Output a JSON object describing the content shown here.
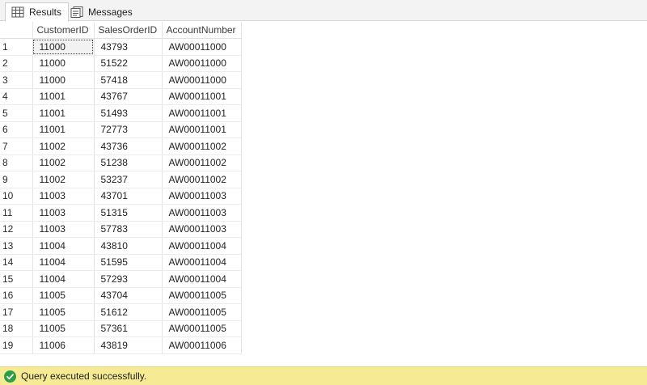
{
  "tabs": {
    "results_label": "Results",
    "messages_label": "Messages",
    "results_icon": "grid-icon",
    "messages_icon": "messages-icon"
  },
  "grid": {
    "columns": [
      "CustomerID",
      "SalesOrderID",
      "AccountNumber"
    ],
    "selected_cell": {
      "row": 1,
      "column": "CustomerID"
    },
    "rows": [
      {
        "n": "1",
        "customer": "11000",
        "order": "43793",
        "account": "AW00011000"
      },
      {
        "n": "2",
        "customer": "11000",
        "order": "51522",
        "account": "AW00011000"
      },
      {
        "n": "3",
        "customer": "11000",
        "order": "57418",
        "account": "AW00011000"
      },
      {
        "n": "4",
        "customer": "11001",
        "order": "43767",
        "account": "AW00011001"
      },
      {
        "n": "5",
        "customer": "11001",
        "order": "51493",
        "account": "AW00011001"
      },
      {
        "n": "6",
        "customer": "11001",
        "order": "72773",
        "account": "AW00011001"
      },
      {
        "n": "7",
        "customer": "11002",
        "order": "43736",
        "account": "AW00011002"
      },
      {
        "n": "8",
        "customer": "11002",
        "order": "51238",
        "account": "AW00011002"
      },
      {
        "n": "9",
        "customer": "11002",
        "order": "53237",
        "account": "AW00011002"
      },
      {
        "n": "10",
        "customer": "11003",
        "order": "43701",
        "account": "AW00011003"
      },
      {
        "n": "11",
        "customer": "11003",
        "order": "51315",
        "account": "AW00011003"
      },
      {
        "n": "12",
        "customer": "11003",
        "order": "57783",
        "account": "AW00011003"
      },
      {
        "n": "13",
        "customer": "11004",
        "order": "43810",
        "account": "AW00011004"
      },
      {
        "n": "14",
        "customer": "11004",
        "order": "51595",
        "account": "AW00011004"
      },
      {
        "n": "15",
        "customer": "11004",
        "order": "57293",
        "account": "AW00011004"
      },
      {
        "n": "16",
        "customer": "11005",
        "order": "43704",
        "account": "AW00011005"
      },
      {
        "n": "17",
        "customer": "11005",
        "order": "51612",
        "account": "AW00011005"
      },
      {
        "n": "18",
        "customer": "11005",
        "order": "57361",
        "account": "AW00011005"
      },
      {
        "n": "19",
        "customer": "11006",
        "order": "43819",
        "account": "AW00011006"
      }
    ]
  },
  "status": {
    "text": "Query executed successfully.",
    "icon": "success-check-icon",
    "bar_color": "#f6eb94",
    "icon_color": "#2f9d47"
  }
}
